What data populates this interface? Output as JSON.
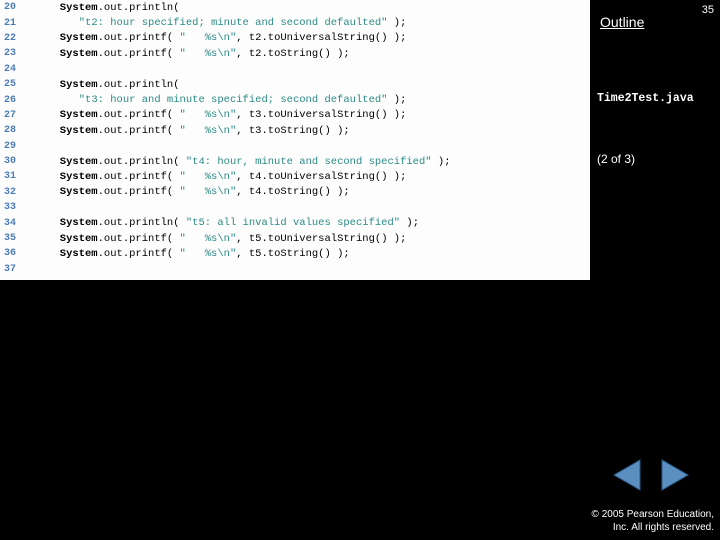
{
  "pageNumber": "35",
  "outlineLabel": "Outline",
  "fileName": "Time2Test.java",
  "partLabel": "(2 of 3)",
  "copyrightLine1": "© 2005 Pearson Education,",
  "copyrightLine2": "Inc.  All rights reserved.",
  "lines": [
    {
      "n": "20",
      "segs": [
        {
          "t": "      System",
          "c": "kw"
        },
        {
          "t": ".out.println("
        }
      ]
    },
    {
      "n": "21",
      "segs": [
        {
          "t": "         "
        },
        {
          "t": "\"t2: hour specified; minute and second defaulted\"",
          "c": "str"
        },
        {
          "t": " );"
        }
      ]
    },
    {
      "n": "22",
      "segs": [
        {
          "t": "      System",
          "c": "kw"
        },
        {
          "t": ".out.printf( "
        },
        {
          "t": "\"   %s\\n\"",
          "c": "str"
        },
        {
          "t": ", t2.toUniversalString() );"
        }
      ]
    },
    {
      "n": "23",
      "segs": [
        {
          "t": "      System",
          "c": "kw"
        },
        {
          "t": ".out.printf( "
        },
        {
          "t": "\"   %s\\n\"",
          "c": "str"
        },
        {
          "t": ", t2.toString() );"
        }
      ]
    },
    {
      "n": "24",
      "segs": []
    },
    {
      "n": "25",
      "segs": [
        {
          "t": "      System",
          "c": "kw"
        },
        {
          "t": ".out.println("
        }
      ]
    },
    {
      "n": "26",
      "segs": [
        {
          "t": "         "
        },
        {
          "t": "\"t3: hour and minute specified; second defaulted\"",
          "c": "str"
        },
        {
          "t": " );"
        }
      ]
    },
    {
      "n": "27",
      "segs": [
        {
          "t": "      System",
          "c": "kw"
        },
        {
          "t": ".out.printf( "
        },
        {
          "t": "\"   %s\\n\"",
          "c": "str"
        },
        {
          "t": ", t3.toUniversalString() );"
        }
      ]
    },
    {
      "n": "28",
      "segs": [
        {
          "t": "      System",
          "c": "kw"
        },
        {
          "t": ".out.printf( "
        },
        {
          "t": "\"   %s\\n\"",
          "c": "str"
        },
        {
          "t": ", t3.toString() );"
        }
      ]
    },
    {
      "n": "29",
      "segs": []
    },
    {
      "n": "30",
      "segs": [
        {
          "t": "      System",
          "c": "kw"
        },
        {
          "t": ".out.println( "
        },
        {
          "t": "\"t4: hour, minute and second specified\"",
          "c": "str"
        },
        {
          "t": " );"
        }
      ]
    },
    {
      "n": "31",
      "segs": [
        {
          "t": "      System",
          "c": "kw"
        },
        {
          "t": ".out.printf( "
        },
        {
          "t": "\"   %s\\n\"",
          "c": "str"
        },
        {
          "t": ", t4.toUniversalString() );"
        }
      ]
    },
    {
      "n": "32",
      "segs": [
        {
          "t": "      System",
          "c": "kw"
        },
        {
          "t": ".out.printf( "
        },
        {
          "t": "\"   %s\\n\"",
          "c": "str"
        },
        {
          "t": ", t4.toString() );"
        }
      ]
    },
    {
      "n": "33",
      "segs": []
    },
    {
      "n": "34",
      "segs": [
        {
          "t": "      System",
          "c": "kw"
        },
        {
          "t": ".out.println( "
        },
        {
          "t": "\"t5: all invalid values specified\"",
          "c": "str"
        },
        {
          "t": " );"
        }
      ]
    },
    {
      "n": "35",
      "segs": [
        {
          "t": "      System",
          "c": "kw"
        },
        {
          "t": ".out.printf( "
        },
        {
          "t": "\"   %s\\n\"",
          "c": "str"
        },
        {
          "t": ", t5.toUniversalString() );"
        }
      ]
    },
    {
      "n": "36",
      "segs": [
        {
          "t": "      System",
          "c": "kw"
        },
        {
          "t": ".out.printf( "
        },
        {
          "t": "\"   %s\\n\"",
          "c": "str"
        },
        {
          "t": ", t5.toString() );"
        }
      ]
    },
    {
      "n": "37",
      "segs": []
    }
  ]
}
